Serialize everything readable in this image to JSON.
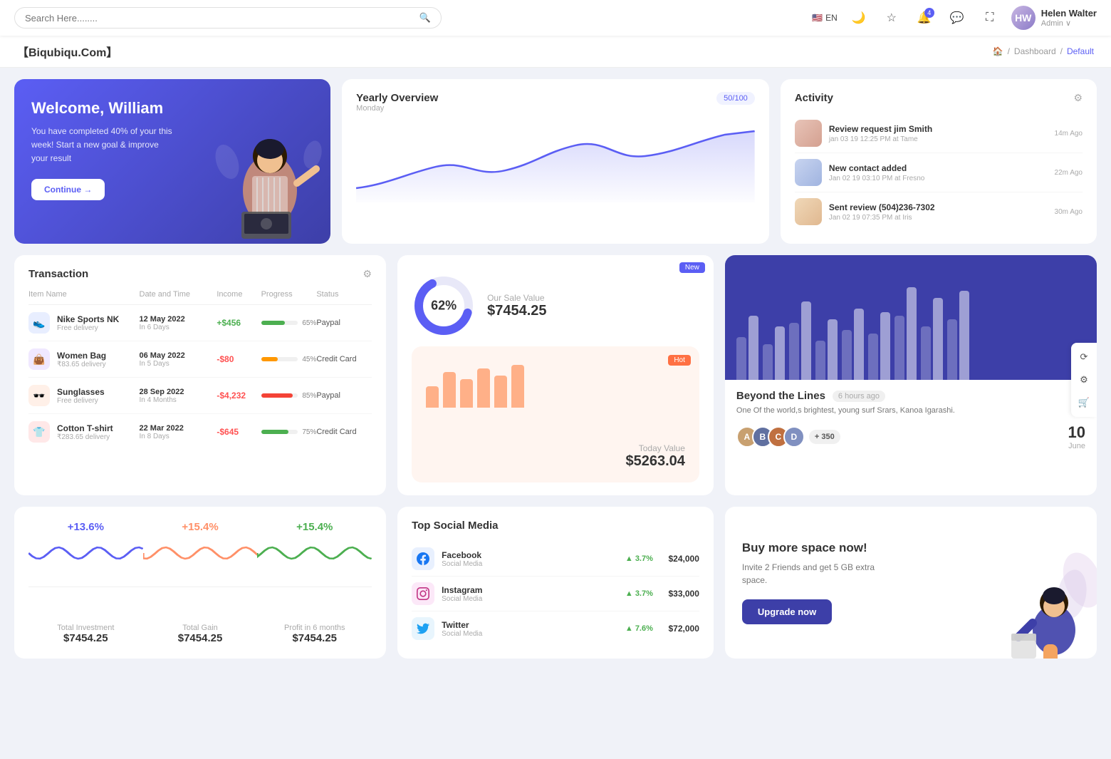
{
  "topnav": {
    "search_placeholder": "Search Here........",
    "lang": "EN",
    "notification_count": "4",
    "user_name": "Helen Walter",
    "user_role": "Admin",
    "user_initials": "HW"
  },
  "breadcrumb": {
    "brand": "【Biqubiqu.Com】",
    "home": "🏠",
    "path1": "Dashboard",
    "path2": "Default"
  },
  "welcome": {
    "title": "Welcome, William",
    "subtitle": "You have completed 40% of your this week! Start a new goal & improve your result",
    "btn_label": "Continue →"
  },
  "yearly_overview": {
    "title": "Yearly Overview",
    "badge": "50/100",
    "subtitle": "Monday"
  },
  "activity": {
    "title": "Activity",
    "items": [
      {
        "title": "Review request jim Smith",
        "sub": "jan 03 19 12:25 PM at Tame",
        "time": "14m Ago",
        "thumb_class": "t1"
      },
      {
        "title": "New contact added",
        "sub": "Jan 02 19 03:10 PM at Fresno",
        "time": "22m Ago",
        "thumb_class": "t2"
      },
      {
        "title": "Sent review (504)236-7302",
        "sub": "Jan 02 19 07:35 PM at Iris",
        "time": "30m Ago",
        "thumb_class": "t3"
      }
    ]
  },
  "transaction": {
    "title": "Transaction",
    "headers": [
      "Item Name",
      "Date and Time",
      "Income",
      "Progress",
      "Status"
    ],
    "rows": [
      {
        "name": "Nike Sports NK",
        "sub": "Free delivery",
        "date": "12 May 2022",
        "date_sub": "In 6 Days",
        "income": "+$456",
        "income_type": "pos",
        "progress": 65,
        "bar_color": "#4caf50",
        "status": "Paypal",
        "icon": "👟",
        "icon_class": "blue"
      },
      {
        "name": "Women Bag",
        "sub": "₹83.65 delivery",
        "date": "06 May 2022",
        "date_sub": "In 5 Days",
        "income": "-$80",
        "income_type": "neg",
        "progress": 45,
        "bar_color": "#ff9800",
        "status": "Credit Card",
        "icon": "👜",
        "icon_class": "purple"
      },
      {
        "name": "Sunglasses",
        "sub": "Free delivery",
        "date": "28 Sep 2022",
        "date_sub": "In 4 Months",
        "income": "-$4,232",
        "income_type": "neg",
        "progress": 85,
        "bar_color": "#f44336",
        "status": "Paypal",
        "icon": "🕶️",
        "icon_class": "orange"
      },
      {
        "name": "Cotton T-shirt",
        "sub": "₹283.65 delivery",
        "date": "22 Mar 2022",
        "date_sub": "In 8 Days",
        "income": "-$645",
        "income_type": "neg",
        "progress": 75,
        "bar_color": "#4caf50",
        "status": "Credit Card",
        "icon": "👕",
        "icon_class": "red"
      }
    ]
  },
  "sale_value": {
    "badge": "New",
    "donut_pct": "62%",
    "label": "Our Sale Value",
    "amount": "$7454.25"
  },
  "today_value": {
    "badge": "Hot",
    "label": "Today Value",
    "amount": "$5263.04",
    "bars": [
      30,
      50,
      40,
      55,
      45,
      60
    ]
  },
  "beyond": {
    "chart_bars": [
      {
        "h1": 60,
        "h2": 90
      },
      {
        "h1": 50,
        "h2": 75
      },
      {
        "h1": 80,
        "h2": 110
      },
      {
        "h1": 55,
        "h2": 85
      },
      {
        "h1": 70,
        "h2": 100
      },
      {
        "h1": 65,
        "h2": 95
      },
      {
        "h1": 90,
        "h2": 130
      },
      {
        "h1": 75,
        "h2": 115
      },
      {
        "h1": 85,
        "h2": 125
      }
    ],
    "title": "Beyond the Lines",
    "time": "6 hours ago",
    "desc": "One Of the world,s brightest, young surf Srars, Kanoa Igarashi.",
    "plus_count": "+ 350",
    "date_num": "10",
    "date_month": "June"
  },
  "stats": {
    "items": [
      {
        "pct": "+13.6%",
        "label": "Total Investment",
        "value": "$7454.25",
        "class": "inv"
      },
      {
        "pct": "+15.4%",
        "label": "Total Gain",
        "value": "$7454.25",
        "class": "gain"
      },
      {
        "pct": "+15.4%",
        "label": "Profit in 6 months",
        "value": "$7454.25",
        "class": "profit"
      }
    ]
  },
  "social": {
    "title": "Top Social Media",
    "items": [
      {
        "platform": "Facebook",
        "sub": "Social Media",
        "growth": "3.7%",
        "value": "$24,000",
        "icon_class": "fb",
        "icon": "f"
      },
      {
        "platform": "Instagram",
        "sub": "Social Media",
        "growth": "3.7%",
        "value": "$33,000",
        "icon_class": "ig",
        "icon": "📷"
      },
      {
        "platform": "Twitter",
        "sub": "Social Media",
        "growth": "7.6%",
        "value": "$72,000",
        "icon_class": "tw",
        "icon": "t"
      }
    ]
  },
  "space": {
    "title": "Buy more space now!",
    "desc": "Invite 2 Friends and get 5 GB extra space.",
    "btn_label": "Upgrade now"
  }
}
